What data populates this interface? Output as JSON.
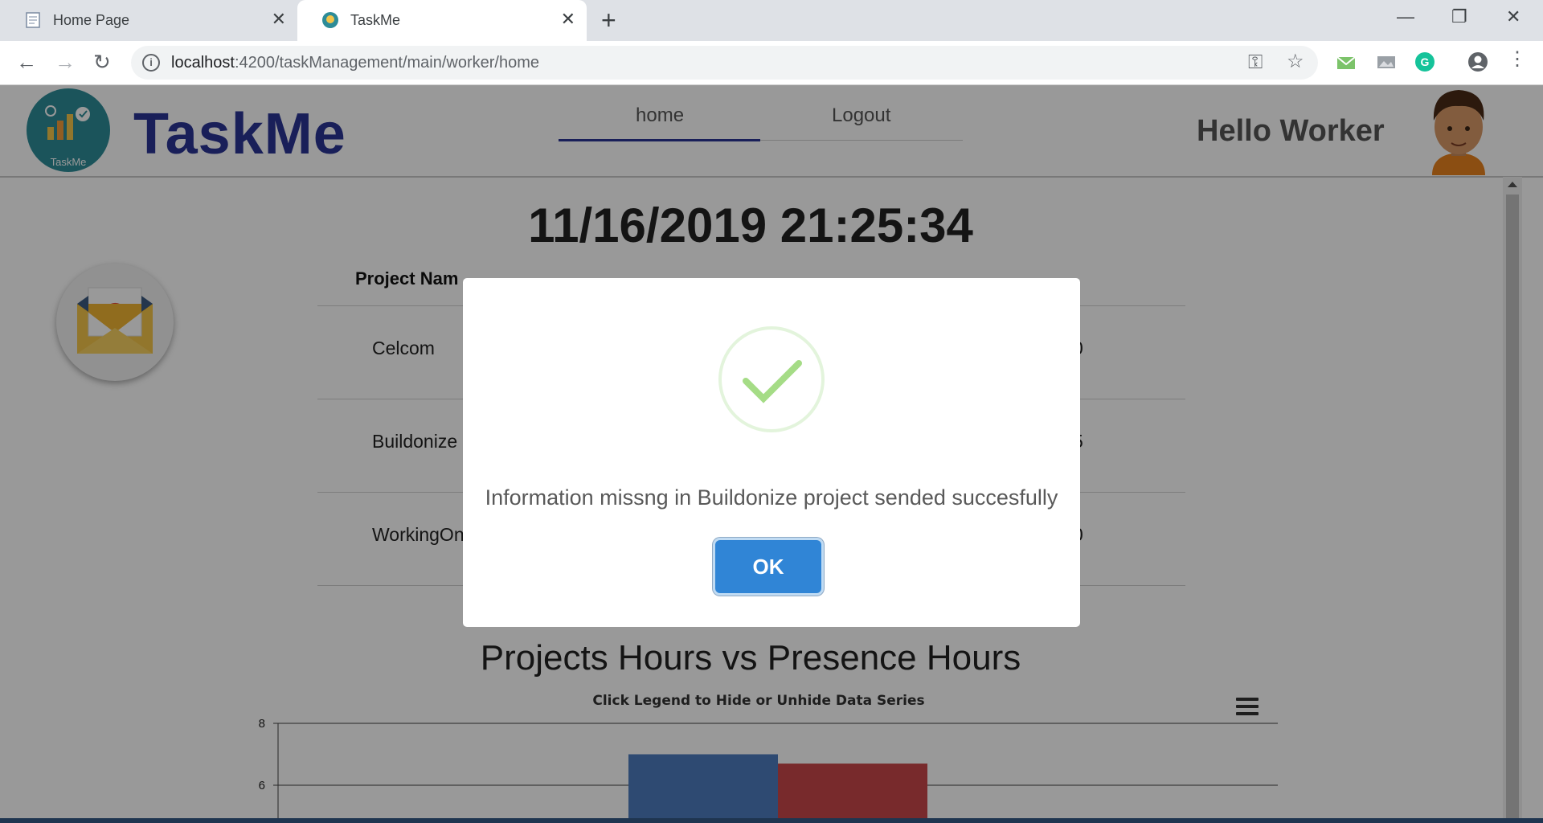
{
  "browser": {
    "tabs": [
      {
        "title": "Home Page",
        "active": false
      },
      {
        "title": "TaskMe",
        "active": true
      }
    ],
    "url_host": "localhost",
    "url_rest": ":4200/taskManagement/main/worker/home"
  },
  "app": {
    "brand": "TaskMe",
    "logo_text": "TaskMe",
    "nav": {
      "home": "home",
      "logout": "Logout",
      "active": "home"
    },
    "greeting": "Hello Worker",
    "clock": "11/16/2019 21:25:34",
    "table": {
      "header": "Project Nam",
      "rows": [
        {
          "name": "Celcom",
          "right": "0"
        },
        {
          "name": "Buildonize",
          "right": "5"
        },
        {
          "name": "WorkingOn",
          "right": "0"
        }
      ]
    }
  },
  "chart_data": {
    "type": "bar",
    "title": "Projects Hours vs Presence Hours",
    "subtitle": "Click Legend to Hide or Unhide Data Series",
    "ylim": [
      4,
      8
    ],
    "ticks": [
      "8",
      "6"
    ],
    "series": [
      {
        "values": [
          7.0
        ],
        "color": "#4d7cbf"
      },
      {
        "values": [
          6.7
        ],
        "color": "#c9474a"
      }
    ]
  },
  "dialog": {
    "message": "Information missng in Buildonize project sended succesfully",
    "ok_label": "OK",
    "icon": "checkmark-icon",
    "colors": {
      "check": "#a5dc86",
      "ok": "#3085d6"
    }
  }
}
